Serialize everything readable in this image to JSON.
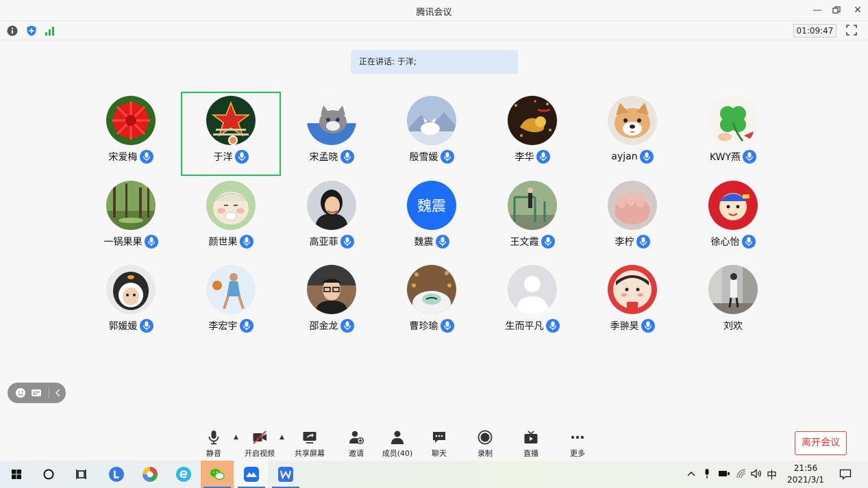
{
  "window": {
    "title": "腾讯会议",
    "timer": "01:09:47"
  },
  "speaking": {
    "text": "正在讲话: 于洋;"
  },
  "participants": [
    {
      "name": "宋爱梅",
      "mic": true,
      "avatar": "red-flower"
    },
    {
      "name": "于洋",
      "mic": true,
      "avatar": "red-star",
      "active": true,
      "host": true
    },
    {
      "name": "宋孟晓",
      "mic": true,
      "avatar": "kitten"
    },
    {
      "name": "殷雪媛",
      "mic": true,
      "avatar": "white-fox"
    },
    {
      "name": "李华",
      "mic": true,
      "avatar": "gold-ornament"
    },
    {
      "name": "ayjan",
      "mic": true,
      "avatar": "shiba-dog"
    },
    {
      "name": "KWY燕",
      "mic": true,
      "avatar": "clover"
    },
    {
      "name": "一锅果果",
      "mic": true,
      "avatar": "forest"
    },
    {
      "name": "颜世果",
      "mic": true,
      "avatar": "cartoon-grandpa"
    },
    {
      "name": "高亚菲",
      "mic": true,
      "avatar": "woman-photo"
    },
    {
      "name": "魏震",
      "mic": true,
      "avatar": "text-avatar",
      "avatar_text": "魏震"
    },
    {
      "name": "王文霞",
      "mic": true,
      "avatar": "outdoor-gym"
    },
    {
      "name": "李柠",
      "mic": true,
      "avatar": "hand"
    },
    {
      "name": "徐心怡",
      "mic": true,
      "avatar": "cartoon-red"
    },
    {
      "name": "郭媛媛",
      "mic": true,
      "avatar": "baby-penguin"
    },
    {
      "name": "李宏宇",
      "mic": true,
      "avatar": "sports-player"
    },
    {
      "name": "邵金龙",
      "mic": true,
      "avatar": "man-glasses"
    },
    {
      "name": "曹珍瑜",
      "mic": true,
      "avatar": "cartoon-face"
    },
    {
      "name": "生而平凡",
      "mic": true,
      "avatar": "default-person"
    },
    {
      "name": "季翀昊",
      "mic": true,
      "avatar": "cartoon-2021"
    },
    {
      "name": "刘欢",
      "mic": false,
      "avatar": "street-photo"
    }
  ],
  "controls": [
    {
      "label": "静音",
      "icon": "microphone-icon"
    },
    {
      "label": "开启视频",
      "icon": "video-off-icon"
    },
    {
      "label": "共享屏幕",
      "icon": "share-screen-icon"
    },
    {
      "label": "邀请",
      "icon": "invite-icon"
    },
    {
      "label": "成员(40)",
      "icon": "members-icon"
    },
    {
      "label": "聊天",
      "icon": "chat-icon"
    },
    {
      "label": "录制",
      "icon": "record-icon"
    },
    {
      "label": "直播",
      "icon": "live-icon"
    },
    {
      "label": "更多",
      "icon": "more-icon"
    }
  ],
  "leave_label": "离开会议",
  "taskbar": {
    "ime": "中",
    "time": "21:56",
    "date": "2021/3/1"
  },
  "colors": {
    "accent": "#2f7cf6",
    "active_border": "#19c25a",
    "leave": "#e33333"
  }
}
